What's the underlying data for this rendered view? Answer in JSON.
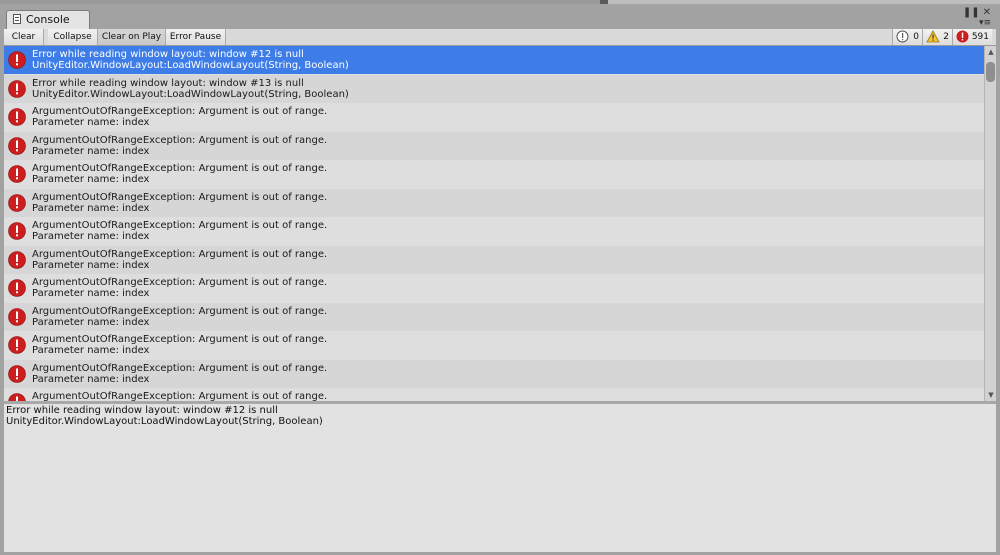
{
  "window": {
    "tab_label": "Console"
  },
  "toolbar": {
    "clear": "Clear",
    "collapse": "Collapse",
    "clear_on_play": "Clear on Play",
    "error_pause": "Error Pause",
    "counters": {
      "log": "0",
      "warning": "2",
      "error": "591"
    }
  },
  "colors": {
    "selected_row": "#3e7de7",
    "error_icon": "#cc1e1e",
    "warning_icon": "#f2c230"
  },
  "icons": {
    "tab": "console-icon",
    "log_counter": "info-icon",
    "warning_counter": "warning-icon",
    "error_counter": "error-icon",
    "row": "error-icon",
    "window_menu": "menu-icon",
    "window_pause": "pause-icon",
    "window_close": "close-icon"
  },
  "log": {
    "rows": [
      {
        "line1": "Error while reading window layout: window #12 is null",
        "line2": "UnityEditor.WindowLayout:LoadWindowLayout(String, Boolean)"
      },
      {
        "line1": "Error while reading window layout: window #13 is null",
        "line2": "UnityEditor.WindowLayout:LoadWindowLayout(String, Boolean)"
      },
      {
        "line1": "ArgumentOutOfRangeException: Argument is out of range.",
        "line2": "Parameter name: index"
      },
      {
        "line1": "ArgumentOutOfRangeException: Argument is out of range.",
        "line2": "Parameter name: index"
      },
      {
        "line1": "ArgumentOutOfRangeException: Argument is out of range.",
        "line2": "Parameter name: index"
      },
      {
        "line1": "ArgumentOutOfRangeException: Argument is out of range.",
        "line2": "Parameter name: index"
      },
      {
        "line1": "ArgumentOutOfRangeException: Argument is out of range.",
        "line2": "Parameter name: index"
      },
      {
        "line1": "ArgumentOutOfRangeException: Argument is out of range.",
        "line2": "Parameter name: index"
      },
      {
        "line1": "ArgumentOutOfRangeException: Argument is out of range.",
        "line2": "Parameter name: index"
      },
      {
        "line1": "ArgumentOutOfRangeException: Argument is out of range.",
        "line2": "Parameter name: index"
      },
      {
        "line1": "ArgumentOutOfRangeException: Argument is out of range.",
        "line2": "Parameter name: index"
      },
      {
        "line1": "ArgumentOutOfRangeException: Argument is out of range.",
        "line2": "Parameter name: index"
      },
      {
        "line1": "ArgumentOutOfRangeException: Argument is out of range.",
        "line2": ""
      }
    ]
  },
  "detail": {
    "line1": "Error while reading window layout: window #12 is null",
    "line2": "UnityEditor.WindowLayout:LoadWindowLayout(String, Boolean)"
  }
}
